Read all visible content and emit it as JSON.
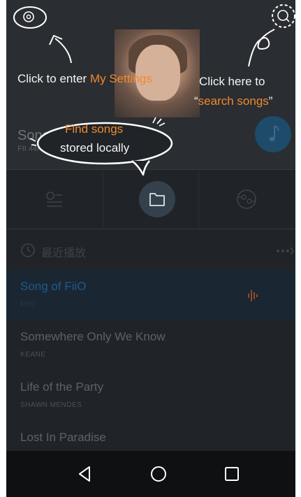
{
  "now_playing": {
    "title": "Song of FiiO",
    "subtitle": "FII 44K"
  },
  "section": {
    "recent_label": "最近播放"
  },
  "songs": [
    {
      "title": "Song of FiiO",
      "artist": "FIIO",
      "active": true
    },
    {
      "title": "Somewhere Only We Know",
      "artist": "KEANE",
      "active": false
    },
    {
      "title": "Life of the Party",
      "artist": "SHAWN MENDES",
      "active": false
    },
    {
      "title": "Lost In Paradise",
      "artist": "",
      "active": false
    }
  ],
  "tips": {
    "settings_prefix": "Click to enter ",
    "settings_highlight": "My Settings",
    "search_line1": "Click here to",
    "search_line2_open": "“",
    "search_highlight": "search songs",
    "search_line2_close": "”",
    "local_highlight": "Find songs",
    "local_line2": "stored locally"
  },
  "colors": {
    "accent_orange": "#f08a2e",
    "accent_blue": "#1e4b6a",
    "overlay_text": "#f4f4f4"
  },
  "icons": {
    "settings": "settings-icon",
    "search": "search-icon",
    "note": "music-note-icon",
    "folder": "folder-icon",
    "playlist": "playlist-icon",
    "library": "library-icon",
    "clock": "clock-icon",
    "more": "more-icon",
    "playing": "playing-bars-icon",
    "back": "back-icon",
    "home": "home-icon",
    "recents": "recents-icon"
  }
}
